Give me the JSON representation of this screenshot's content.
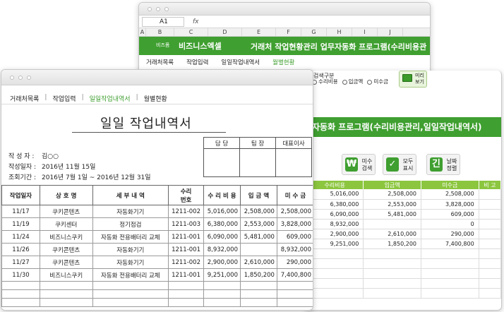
{
  "back": {
    "cell_ref": "A1",
    "fx": "fx",
    "columns": [
      "A",
      "B",
      "C",
      "D",
      "E",
      "F",
      "G",
      "H",
      "I",
      "J"
    ],
    "brand_small": "비즈폼",
    "brand": "비즈니스엑셀",
    "title": "거래처 작업현황관리 업무자동화 프로그램(수리비용관",
    "nav": [
      "거래처목록",
      "작업입력",
      "일일작업내역서",
      "월별현황"
    ]
  },
  "mid": {
    "search_label": "검색구분",
    "radios": [
      "수리비용",
      "입금액",
      "미수금"
    ],
    "preview_label": "미리 보기",
    "title": "자동화 프로그램(수리비용관리,일일작업내역서)",
    "tools": [
      {
        "icon": "₩",
        "label": "미수 검색",
        "color": "#3f9f30"
      },
      {
        "icon": "✓",
        "label": "모두 표시",
        "color": "#3f9f30"
      },
      {
        "icon": "긴",
        "label": "날짜 정렬",
        "color": "#3f9f30"
      }
    ],
    "headers": [
      "수리비용",
      "입금액",
      "미수금",
      "비 고"
    ],
    "rows": [
      [
        "5,016,000",
        "2,508,000",
        "2,508,000",
        ""
      ],
      [
        "6,380,000",
        "2,553,000",
        "3,828,000",
        ""
      ],
      [
        "6,090,000",
        "5,481,000",
        "609,000",
        ""
      ],
      [
        "8,932,000",
        "",
        "0",
        ""
      ],
      [
        "2,900,000",
        "2,610,000",
        "290,000",
        ""
      ],
      [
        "9,251,000",
        "1,850,200",
        "7,400,800",
        ""
      ],
      [
        "",
        "",
        "",
        ""
      ],
      [
        "",
        "",
        "",
        ""
      ],
      [
        "",
        "",
        "",
        ""
      ],
      [
        "",
        "",
        "",
        ""
      ],
      [
        "",
        "",
        "",
        ""
      ]
    ]
  },
  "front": {
    "nav": [
      "거래처목록",
      "작업입력",
      "일일작업내역서",
      "월별현황"
    ],
    "title": "일일 작업내역서",
    "approval_headers": [
      "담 당",
      "팀 장",
      "대표이사"
    ],
    "writer_label": "작 성 자 :",
    "writer_value": "김○○",
    "date_label": "작성일자 :",
    "date_value": "2016년 11월 15일",
    "period_label": "조회기간 :",
    "period_value": "2016년 7월 1일 ~ 2016년 12월 31일",
    "headers": [
      "작업일자",
      "상 호 명",
      "세 부 내 역",
      "수리\n번호",
      "수 리 비 용",
      "입 금 액",
      "미 수 금"
    ],
    "rows": [
      [
        "11/17",
        "쿠키콘텐츠",
        "자동화기기",
        "1211-002",
        "5,016,000",
        "2,508,000",
        "2,508,000"
      ],
      [
        "11/19",
        "쿠키센터",
        "정기점검",
        "1211-003",
        "6,380,000",
        "2,553,000",
        "3,828,000"
      ],
      [
        "11/24",
        "비즈니스쿠키",
        "자동화 전용배터리 교체",
        "1211-001",
        "6,090,000",
        "5,481,000",
        "609,000"
      ],
      [
        "11/26",
        "쿠키콘텐츠",
        "자동화기기",
        "1211-001",
        "8,932,000",
        "",
        "8,932,000"
      ],
      [
        "11/27",
        "쿠키콘텐츠",
        "자동화기기",
        "1211-002",
        "2,900,000",
        "2,610,000",
        "290,000"
      ],
      [
        "11/30",
        "비즈니스쿠키",
        "자동화 전용배터리 교체",
        "1211-001",
        "9,251,000",
        "1,850,200",
        "7,400,800"
      ]
    ],
    "blank_rows": 3
  }
}
